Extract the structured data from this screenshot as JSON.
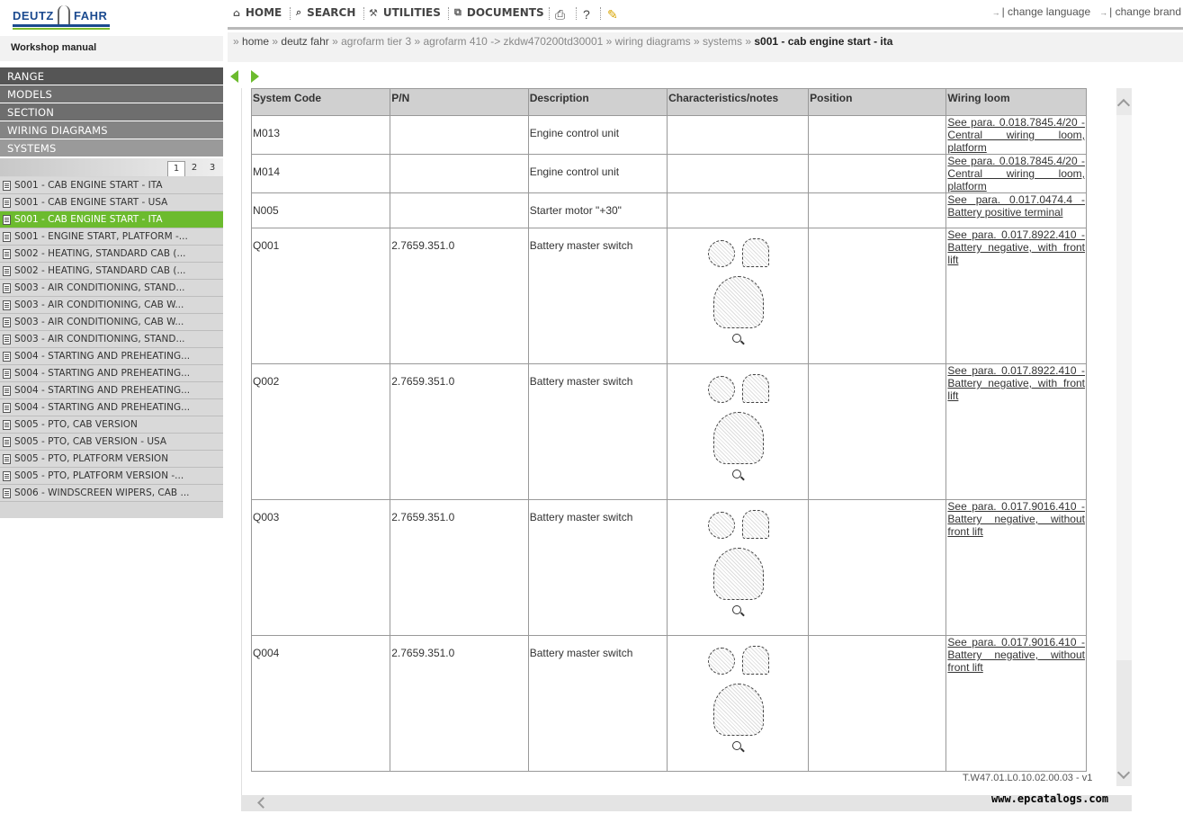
{
  "brand": {
    "left": "DEUTZ",
    "right": "FAHR",
    "colors": {
      "blue": "#1b4a8f",
      "green": "#7dbb2f"
    }
  },
  "manual_title": "Workshop manual",
  "nav": [
    "RANGE",
    "MODELS",
    "SECTION",
    "WIRING DIAGRAMS",
    "SYSTEMS"
  ],
  "pager": [
    "1",
    "2",
    "3"
  ],
  "systems": [
    "S001 - CAB ENGINE START - ITA",
    "S001 - CAB ENGINE START - USA",
    "S001 - CAB ENGINE START - ITA",
    "S001 - ENGINE START, PLATFORM -...",
    "S002 - HEATING, STANDARD CAB (...",
    "S002 - HEATING, STANDARD CAB (...",
    "S003 - AIR CONDITIONING, STAND...",
    "S003 - AIR CONDITIONING, CAB W...",
    "S003 - AIR CONDITIONING, CAB W...",
    "S003 - AIR CONDITIONING, STAND...",
    "S004 - STARTING AND PREHEATING...",
    "S004 - STARTING AND PREHEATING...",
    "S004 - STARTING AND PREHEATING...",
    "S004 - STARTING AND PREHEATING...",
    "S005 - PTO, CAB VERSION",
    "S005 - PTO, CAB VERSION - USA",
    "S005 - PTO, PLATFORM VERSION",
    "S005 - PTO, PLATFORM VERSION -...",
    "S006 - WINDSCREEN WIPERS, CAB ..."
  ],
  "selected_color": "#6cbb2e",
  "menu": {
    "home": "HOME",
    "search": "SEARCH",
    "utilities": "UTILITIES",
    "documents": "DOCUMENTS"
  },
  "links": {
    "language": "| change language",
    "brand": "| change brand"
  },
  "breadcrumb": [
    "home",
    "deutz fahr",
    "agrofarm tier 3",
    "agrofarm 410",
    "zkdw470200td30001",
    "wiring diagrams",
    "systems",
    "s001 - cab engine start - ita"
  ],
  "table": {
    "headers": [
      "System Code",
      "P/N",
      "Description",
      "Characteristics/notes",
      "Position",
      "Wiring loom"
    ],
    "rows": [
      {
        "code": "M013",
        "pn": "",
        "desc": "Engine control unit",
        "loom": "See para. 0.018.7845.4/20 - Central wiring loom, platform"
      },
      {
        "code": "M014",
        "pn": "",
        "desc": "Engine control unit",
        "loom": "See para. 0.018.7845.4/20 - Central wiring loom, platform"
      },
      {
        "code": "N005",
        "pn": "",
        "desc": "Starter motor \"+30\"",
        "loom": "See para. 0.017.0474.4 - Battery positive terminal"
      },
      {
        "code": "Q001",
        "pn": "2.7659.351.0",
        "desc": "Battery master switch",
        "loom": "See para. 0.017.8922.410 - Battery negative, with front lift"
      },
      {
        "code": "Q002",
        "pn": "2.7659.351.0",
        "desc": "Battery master switch",
        "loom": "See para. 0.017.8922.410 - Battery negative, with front lift"
      },
      {
        "code": "Q003",
        "pn": "2.7659.351.0",
        "desc": "Battery master switch",
        "loom": "See para. 0.017.9016.410 - Battery negative, without front lift"
      },
      {
        "code": "Q004",
        "pn": "2.7659.351.0",
        "desc": "Battery master switch",
        "loom": "See para. 0.017.9016.410 - Battery negative, without front lift"
      }
    ]
  },
  "version": "T.W47.01.L0.10.02.00.03 - v1",
  "watermark": "www.epcatalogs.com"
}
